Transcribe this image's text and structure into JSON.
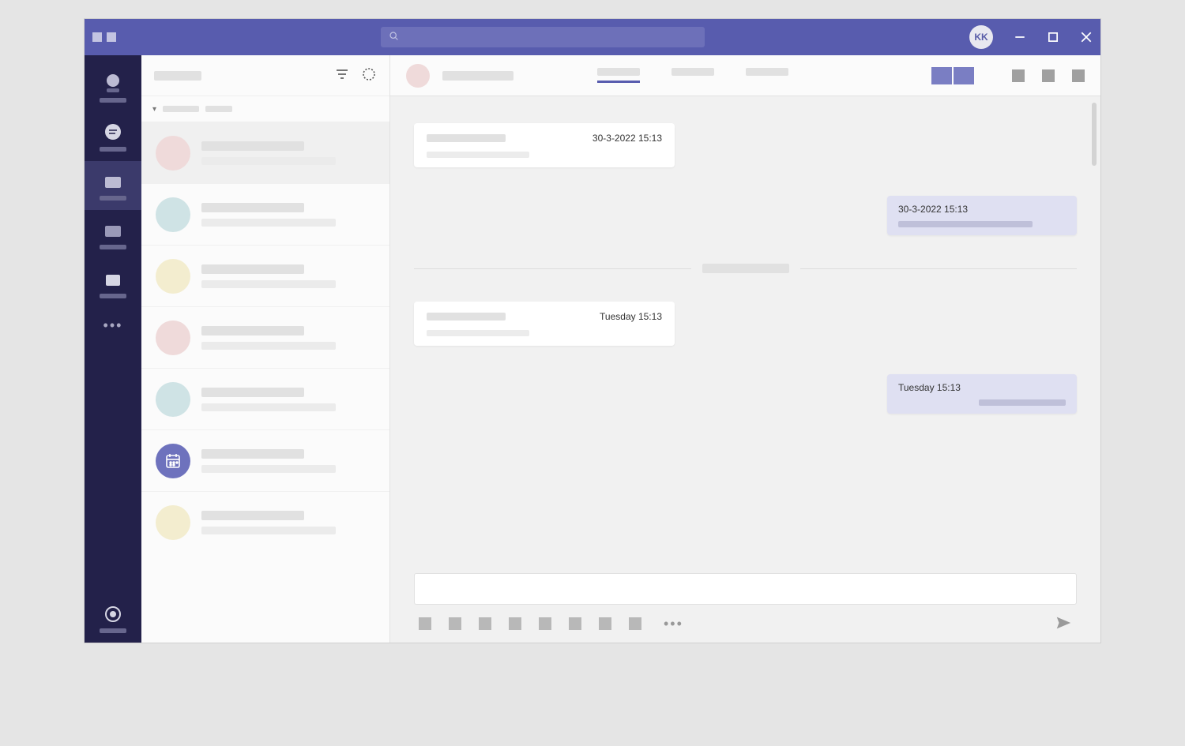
{
  "colors": {
    "brand": "#585cae",
    "rail": "#23214a",
    "bubble_out": "#dfe0f2"
  },
  "titlebar": {
    "search_placeholder": "",
    "avatar_initials": "KK"
  },
  "rail": {
    "items": [
      {
        "icon": "activity"
      },
      {
        "icon": "chat"
      },
      {
        "icon": "teams"
      },
      {
        "icon": "assignments"
      },
      {
        "icon": "files"
      }
    ]
  },
  "sidebar": {
    "contacts": [
      {
        "avatar": "#efdada",
        "icon": null
      },
      {
        "avatar": "#cfe3e5",
        "icon": null
      },
      {
        "avatar": "#f3edcf",
        "icon": null
      },
      {
        "avatar": "#efdada",
        "icon": null
      },
      {
        "avatar": "#cfe3e5",
        "icon": null
      },
      {
        "avatar": "#6e72bd",
        "icon": "calendar"
      },
      {
        "avatar": "#f3edcf",
        "icon": null
      }
    ]
  },
  "chat": {
    "messages": [
      {
        "dir": "in",
        "timestamp": "30-3-2022  15:13"
      },
      {
        "dir": "out",
        "timestamp": "30-3-2022  15:13"
      },
      {
        "dir": "divider"
      },
      {
        "dir": "in",
        "timestamp": "Tuesday 15:13"
      },
      {
        "dir": "out",
        "timestamp": "Tuesday 15:13",
        "small": true
      }
    ]
  }
}
